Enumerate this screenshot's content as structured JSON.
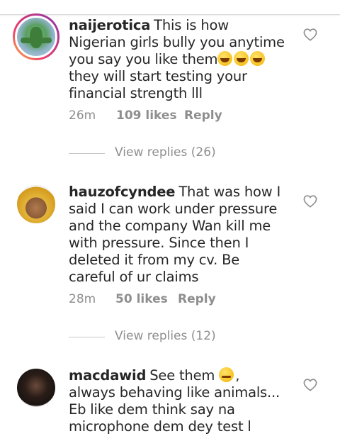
{
  "comments": [
    {
      "username": "naijerotica",
      "text_a": "This is how Nigerian girls bully you anytime you say you like them",
      "emojis": [
        "grinning-face-icon",
        "grinning-face-icon",
        "grinning-face-icon"
      ],
      "text_b": " they will start testing your financial strength lll",
      "time": "26m",
      "likes": "109 likes",
      "reply": "Reply",
      "view_replies": "View replies (26)"
    },
    {
      "username": "hauzofcyndee",
      "text_a": "That was how I said I  can work under pressure and the company Wan kill me with pressure. Since then I deleted it from my cv. Be careful of ur claims",
      "time": "28m",
      "likes": "50 likes",
      "reply": "Reply",
      "view_replies": "View replies (12)"
    },
    {
      "username": "macdawid",
      "text_a": "See them ",
      "emojis": [
        "smirking-face-icon"
      ],
      "text_b": ", always behaving like animals... Eb like dem think say na microphone dem dey test l",
      "time": "",
      "likes": "",
      "reply": ""
    }
  ],
  "colors": {
    "text": "#262626",
    "secondary": "#8e8e8e",
    "story_ring": "#c13584"
  },
  "icons": {
    "like": "heart-outline-icon"
  }
}
